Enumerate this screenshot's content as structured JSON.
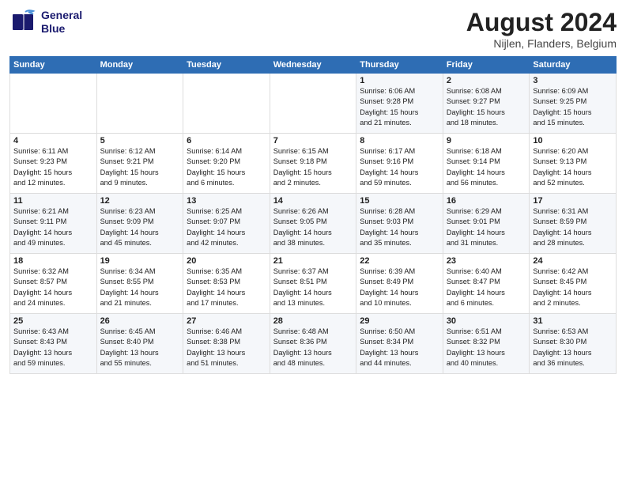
{
  "logo": {
    "line1": "General",
    "line2": "Blue"
  },
  "title": "August 2024",
  "subtitle": "Nijlen, Flanders, Belgium",
  "days_of_week": [
    "Sunday",
    "Monday",
    "Tuesday",
    "Wednesday",
    "Thursday",
    "Friday",
    "Saturday"
  ],
  "weeks": [
    [
      {
        "day": "",
        "info": ""
      },
      {
        "day": "",
        "info": ""
      },
      {
        "day": "",
        "info": ""
      },
      {
        "day": "",
        "info": ""
      },
      {
        "day": "1",
        "info": "Sunrise: 6:06 AM\nSunset: 9:28 PM\nDaylight: 15 hours\nand 21 minutes."
      },
      {
        "day": "2",
        "info": "Sunrise: 6:08 AM\nSunset: 9:27 PM\nDaylight: 15 hours\nand 18 minutes."
      },
      {
        "day": "3",
        "info": "Sunrise: 6:09 AM\nSunset: 9:25 PM\nDaylight: 15 hours\nand 15 minutes."
      }
    ],
    [
      {
        "day": "4",
        "info": "Sunrise: 6:11 AM\nSunset: 9:23 PM\nDaylight: 15 hours\nand 12 minutes."
      },
      {
        "day": "5",
        "info": "Sunrise: 6:12 AM\nSunset: 9:21 PM\nDaylight: 15 hours\nand 9 minutes."
      },
      {
        "day": "6",
        "info": "Sunrise: 6:14 AM\nSunset: 9:20 PM\nDaylight: 15 hours\nand 6 minutes."
      },
      {
        "day": "7",
        "info": "Sunrise: 6:15 AM\nSunset: 9:18 PM\nDaylight: 15 hours\nand 2 minutes."
      },
      {
        "day": "8",
        "info": "Sunrise: 6:17 AM\nSunset: 9:16 PM\nDaylight: 14 hours\nand 59 minutes."
      },
      {
        "day": "9",
        "info": "Sunrise: 6:18 AM\nSunset: 9:14 PM\nDaylight: 14 hours\nand 56 minutes."
      },
      {
        "day": "10",
        "info": "Sunrise: 6:20 AM\nSunset: 9:13 PM\nDaylight: 14 hours\nand 52 minutes."
      }
    ],
    [
      {
        "day": "11",
        "info": "Sunrise: 6:21 AM\nSunset: 9:11 PM\nDaylight: 14 hours\nand 49 minutes."
      },
      {
        "day": "12",
        "info": "Sunrise: 6:23 AM\nSunset: 9:09 PM\nDaylight: 14 hours\nand 45 minutes."
      },
      {
        "day": "13",
        "info": "Sunrise: 6:25 AM\nSunset: 9:07 PM\nDaylight: 14 hours\nand 42 minutes."
      },
      {
        "day": "14",
        "info": "Sunrise: 6:26 AM\nSunset: 9:05 PM\nDaylight: 14 hours\nand 38 minutes."
      },
      {
        "day": "15",
        "info": "Sunrise: 6:28 AM\nSunset: 9:03 PM\nDaylight: 14 hours\nand 35 minutes."
      },
      {
        "day": "16",
        "info": "Sunrise: 6:29 AM\nSunset: 9:01 PM\nDaylight: 14 hours\nand 31 minutes."
      },
      {
        "day": "17",
        "info": "Sunrise: 6:31 AM\nSunset: 8:59 PM\nDaylight: 14 hours\nand 28 minutes."
      }
    ],
    [
      {
        "day": "18",
        "info": "Sunrise: 6:32 AM\nSunset: 8:57 PM\nDaylight: 14 hours\nand 24 minutes."
      },
      {
        "day": "19",
        "info": "Sunrise: 6:34 AM\nSunset: 8:55 PM\nDaylight: 14 hours\nand 21 minutes."
      },
      {
        "day": "20",
        "info": "Sunrise: 6:35 AM\nSunset: 8:53 PM\nDaylight: 14 hours\nand 17 minutes."
      },
      {
        "day": "21",
        "info": "Sunrise: 6:37 AM\nSunset: 8:51 PM\nDaylight: 14 hours\nand 13 minutes."
      },
      {
        "day": "22",
        "info": "Sunrise: 6:39 AM\nSunset: 8:49 PM\nDaylight: 14 hours\nand 10 minutes."
      },
      {
        "day": "23",
        "info": "Sunrise: 6:40 AM\nSunset: 8:47 PM\nDaylight: 14 hours\nand 6 minutes."
      },
      {
        "day": "24",
        "info": "Sunrise: 6:42 AM\nSunset: 8:45 PM\nDaylight: 14 hours\nand 2 minutes."
      }
    ],
    [
      {
        "day": "25",
        "info": "Sunrise: 6:43 AM\nSunset: 8:43 PM\nDaylight: 13 hours\nand 59 minutes."
      },
      {
        "day": "26",
        "info": "Sunrise: 6:45 AM\nSunset: 8:40 PM\nDaylight: 13 hours\nand 55 minutes."
      },
      {
        "day": "27",
        "info": "Sunrise: 6:46 AM\nSunset: 8:38 PM\nDaylight: 13 hours\nand 51 minutes."
      },
      {
        "day": "28",
        "info": "Sunrise: 6:48 AM\nSunset: 8:36 PM\nDaylight: 13 hours\nand 48 minutes."
      },
      {
        "day": "29",
        "info": "Sunrise: 6:50 AM\nSunset: 8:34 PM\nDaylight: 13 hours\nand 44 minutes."
      },
      {
        "day": "30",
        "info": "Sunrise: 6:51 AM\nSunset: 8:32 PM\nDaylight: 13 hours\nand 40 minutes."
      },
      {
        "day": "31",
        "info": "Sunrise: 6:53 AM\nSunset: 8:30 PM\nDaylight: 13 hours\nand 36 minutes."
      }
    ]
  ]
}
